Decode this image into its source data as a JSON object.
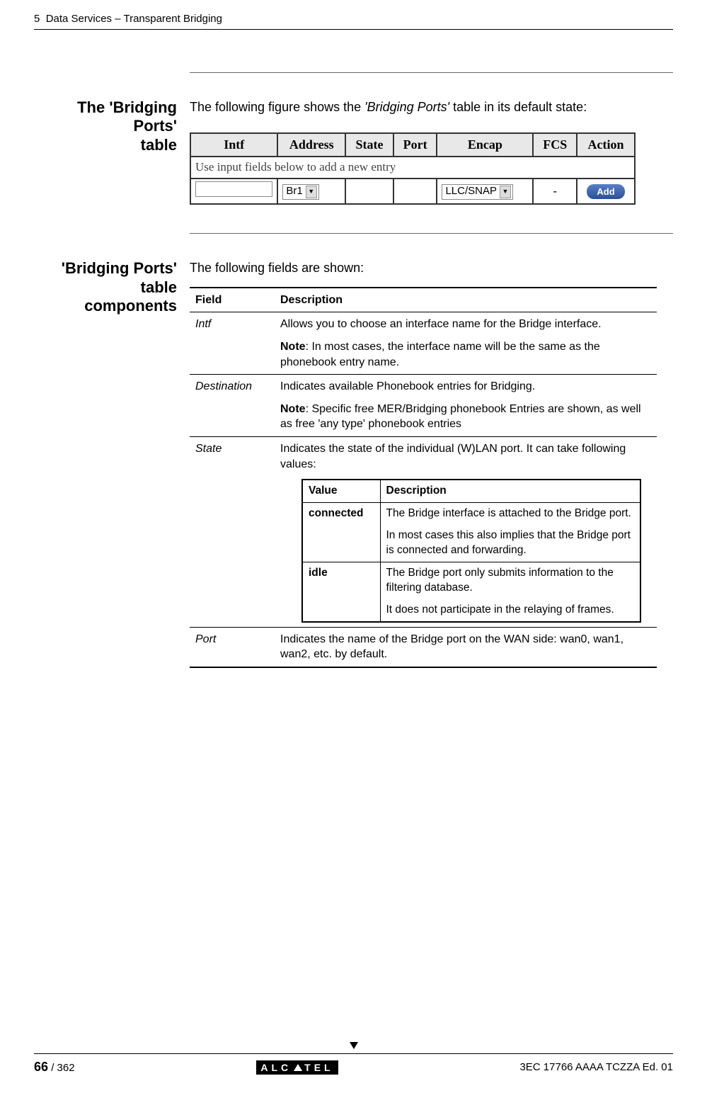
{
  "header": {
    "chapter_num": "5",
    "chapter_title": "Data Services – Transparent Bridging"
  },
  "section1": {
    "label_line1": "The 'Bridging Ports'",
    "label_line2": "table",
    "intro_pre": "The following figure shows the ",
    "intro_italic": "'Bridging Ports'",
    "intro_post": " table in its default state:",
    "table": {
      "headers": [
        "Intf",
        "Address",
        "State",
        "Port",
        "Encap",
        "FCS",
        "Action"
      ],
      "hint": "Use input fields below to add a new entry",
      "address_select": "Br1",
      "encap_select": "LLC/SNAP",
      "fcs_value": "-",
      "add_label": "Add"
    }
  },
  "section2": {
    "label_line1": "'Bridging Ports' table",
    "label_line2": "components",
    "intro": "The following fields are shown:",
    "fields_table": {
      "header_field": "Field",
      "header_desc": "Description",
      "rows": {
        "intf": {
          "name": "Intf",
          "desc_line1": "Allows you to choose an interface name for the Bridge interface.",
          "note_label": "Note",
          "note_text": ": In most cases, the interface name will be the same as the phonebook entry name."
        },
        "destination": {
          "name": "Destination",
          "desc_line1": "Indicates available Phonebook entries for Bridging.",
          "note_label": "Note",
          "note_text": ": Specific free MER/Bridging phonebook Entries are shown, as well as free 'any type' phonebook entries"
        },
        "state": {
          "name": "State",
          "desc_line1": "Indicates the state of the individual (W)LAN port. It can take following values:",
          "nested": {
            "header_value": "Value",
            "header_desc": "Description",
            "connected": {
              "name": "connected",
              "d1": "The Bridge interface is attached to the Bridge port.",
              "d2": "In most cases this also implies that the Bridge port is connected and forwarding."
            },
            "idle": {
              "name": "idle",
              "d1": "The Bridge port only submits information to the filtering database.",
              "d2": "It does not participate in the relaying of frames."
            }
          }
        },
        "port": {
          "name": "Port",
          "desc": "Indicates the name of the Bridge port on the WAN side: wan0, wan1, wan2, etc. by default."
        }
      }
    }
  },
  "footer": {
    "page_current": "66",
    "page_total": " / 362",
    "brand_left": "ALC",
    "brand_right": "TEL",
    "doc_ref": "3EC 17766 AAAA TCZZA Ed. 01"
  }
}
